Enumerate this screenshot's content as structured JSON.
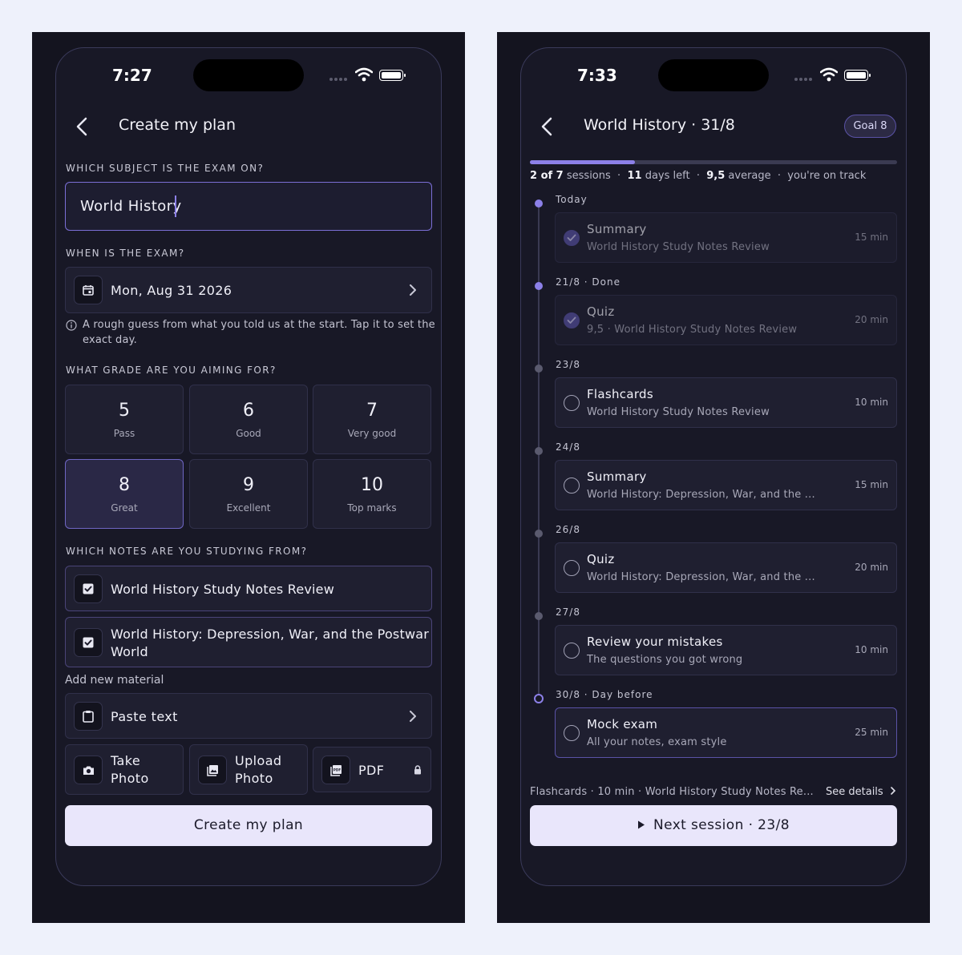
{
  "left": {
    "status_time": "7:27",
    "title": "Create my plan",
    "subject_label": "WHICH SUBJECT IS THE EXAM ON?",
    "subject_value": "World History",
    "date_label": "WHEN IS THE EXAM?",
    "date_value": "Mon, Aug 31 2026",
    "hint_line1": "A rough guess from what you told us at the start. Tap it to set the",
    "hint_line2": "exact day.",
    "grade_label": "WHAT GRADE ARE YOU AIMING FOR?",
    "grades": [
      {
        "value": "5",
        "label": "Pass"
      },
      {
        "value": "6",
        "label": "Good"
      },
      {
        "value": "7",
        "label": "Very good"
      },
      {
        "value": "8",
        "label": "Great"
      },
      {
        "value": "9",
        "label": "Excellent"
      },
      {
        "value": "10",
        "label": "Top marks"
      }
    ],
    "selected_grade": "8",
    "notes_label": "WHICH NOTES ARE YOU STUDYING FROM?",
    "notes": [
      {
        "line1": "World History Study Notes Review",
        "line2": ""
      },
      {
        "line1": "World History: Depression, War, and the Postwar",
        "line2": "World"
      }
    ],
    "add_material_label": "Add new material",
    "paste_text": "Paste text",
    "take_photo_1": "Take",
    "take_photo_2": "Photo",
    "upload_photo_1": "Upload",
    "upload_photo_2": "Photo",
    "pdf": "PDF",
    "create_button": "Create my plan"
  },
  "right": {
    "status_time": "7:33",
    "title": "World History · 31/8",
    "goal_badge": "Goal 8",
    "progress": 0.286,
    "stats": {
      "sessions_count": "2 of 7",
      "sessions_word": "sessions",
      "days_count": "11",
      "days_word": "days left",
      "average_value": "9,5",
      "average_word": "average",
      "track": "you're on track",
      "sep": "·"
    },
    "timeline": [
      {
        "day": "Today",
        "title": "Summary",
        "sub": "World History Study Notes Review",
        "dur": "15 min",
        "done": true
      },
      {
        "day": "21/8 · Done",
        "title": "Quiz",
        "sub": "9,5 · World History Study Notes Review",
        "dur": "20 min",
        "done": true
      },
      {
        "day": "23/8",
        "title": "Flashcards",
        "sub": "World History Study Notes Review",
        "dur": "10 min",
        "done": false
      },
      {
        "day": "24/8",
        "title": "Summary",
        "sub": "World History: Depression, War, and the ...",
        "dur": "15 min",
        "done": false
      },
      {
        "day": "26/8",
        "title": "Quiz",
        "sub": "World History: Depression, War, and the ...",
        "dur": "20 min",
        "done": false
      },
      {
        "day": "27/8",
        "title": "Review your mistakes",
        "sub": "The questions you got wrong",
        "dur": "10 min",
        "done": false
      },
      {
        "day": "30/8 · Day before",
        "title": "Mock exam",
        "sub": "All your notes, exam style",
        "dur": "25 min",
        "done": false
      }
    ],
    "footer_info": "Flashcards · 10 min · World History Study Notes Re...",
    "see_details": "See details",
    "next_button": "Next session · 23/8"
  },
  "colors": {
    "background": "#eef1fb",
    "panel": "#14141f",
    "accent": "#8c80e8",
    "button": "#e9e6fb"
  }
}
